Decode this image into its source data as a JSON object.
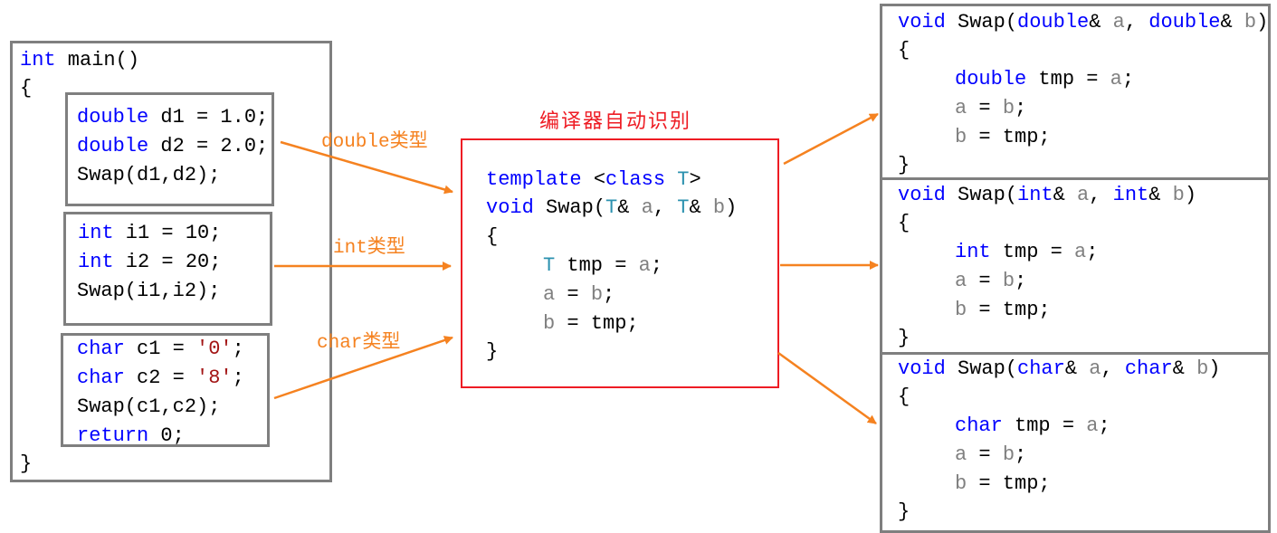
{
  "colors": {
    "arrow": "#f58220",
    "compiler_box": "#ee1c24",
    "box_border": "#7f7f7f",
    "keyword": "#0000ff",
    "type_param": "#2b91af",
    "param": "#808080",
    "literal": "#a31515"
  },
  "compiler_title": "编译器自动识别",
  "arrow_labels": {
    "double": "double类型",
    "int": "int类型",
    "char": "char类型"
  },
  "main_code": [
    [
      [
        "kw",
        "int"
      ],
      [
        "tx",
        " main()"
      ]
    ],
    [
      [
        "tx",
        "{"
      ]
    ],
    [
      [
        "kw",
        "double"
      ],
      [
        "tx",
        " d1 = 1.0;"
      ]
    ],
    [
      [
        "kw",
        "double"
      ],
      [
        "tx",
        " d2 = 2.0;"
      ]
    ],
    [
      [
        "tx",
        "Swap(d1,d2);"
      ]
    ],
    [
      [
        "kw",
        "int"
      ],
      [
        "tx",
        " i1 = 10;"
      ]
    ],
    [
      [
        "kw",
        "int"
      ],
      [
        "tx",
        " i2 = 20;"
      ]
    ],
    [
      [
        "tx",
        "Swap(i1,i2);"
      ]
    ],
    [
      [
        "kw",
        "char"
      ],
      [
        "tx",
        " c1 = "
      ],
      [
        "lit",
        "'0'"
      ],
      [
        "tx",
        ";"
      ]
    ],
    [
      [
        "kw",
        "char"
      ],
      [
        "tx",
        " c2 = "
      ],
      [
        "lit",
        "'8'"
      ],
      [
        "tx",
        ";"
      ]
    ],
    [
      [
        "tx",
        "Swap(c1,c2);"
      ]
    ],
    [
      [
        "kw",
        "return"
      ],
      [
        "tx",
        " 0;"
      ]
    ],
    [
      [
        "tx",
        "}"
      ]
    ]
  ],
  "template_code": [
    [
      [
        "kw",
        "template"
      ],
      [
        "tx",
        " <"
      ],
      [
        "kw",
        "class"
      ],
      [
        "tx",
        " "
      ],
      [
        "ty",
        "T"
      ],
      [
        "tx",
        ">"
      ]
    ],
    [
      [
        "kw",
        "void"
      ],
      [
        "tx",
        " Swap("
      ],
      [
        "ty",
        "T"
      ],
      [
        "tx",
        "& "
      ],
      [
        "pa",
        "a"
      ],
      [
        "tx",
        ", "
      ],
      [
        "ty",
        "T"
      ],
      [
        "tx",
        "& "
      ],
      [
        "pa",
        "b"
      ],
      [
        "tx",
        ")"
      ]
    ],
    [
      [
        "tx",
        "{"
      ]
    ],
    [
      [
        "ty",
        "T"
      ],
      [
        "tx",
        " tmp = "
      ],
      [
        "pa",
        "a"
      ],
      [
        "tx",
        ";"
      ]
    ],
    [
      [
        "pa",
        "a"
      ],
      [
        "tx",
        " = "
      ],
      [
        "pa",
        "b"
      ],
      [
        "tx",
        ";"
      ]
    ],
    [
      [
        "pa",
        "b"
      ],
      [
        "tx",
        " = tmp;"
      ]
    ],
    [
      [
        "tx",
        "}"
      ]
    ]
  ],
  "instances": [
    [
      [
        [
          "kw",
          "void"
        ],
        [
          "tx",
          " Swap("
        ],
        [
          "kw",
          "double"
        ],
        [
          "tx",
          "& "
        ],
        [
          "pa",
          "a"
        ],
        [
          "tx",
          ", "
        ],
        [
          "kw",
          "double"
        ],
        [
          "tx",
          "& "
        ],
        [
          "pa",
          "b"
        ],
        [
          "tx",
          ")"
        ]
      ],
      [
        [
          "tx",
          "{"
        ]
      ],
      [
        [
          "kw",
          "double"
        ],
        [
          "tx",
          " tmp = "
        ],
        [
          "pa",
          "a"
        ],
        [
          "tx",
          ";"
        ]
      ],
      [
        [
          "pa",
          "a"
        ],
        [
          "tx",
          " = "
        ],
        [
          "pa",
          "b"
        ],
        [
          "tx",
          ";"
        ]
      ],
      [
        [
          "pa",
          "b"
        ],
        [
          "tx",
          " = tmp;"
        ]
      ],
      [
        [
          "tx",
          "}"
        ]
      ]
    ],
    [
      [
        [
          "kw",
          "void"
        ],
        [
          "tx",
          " Swap("
        ],
        [
          "kw",
          "int"
        ],
        [
          "tx",
          "& "
        ],
        [
          "pa",
          "a"
        ],
        [
          "tx",
          ", "
        ],
        [
          "kw",
          "int"
        ],
        [
          "tx",
          "& "
        ],
        [
          "pa",
          "b"
        ],
        [
          "tx",
          ")"
        ]
      ],
      [
        [
          "tx",
          "{"
        ]
      ],
      [
        [
          "kw",
          "int"
        ],
        [
          "tx",
          " tmp = "
        ],
        [
          "pa",
          "a"
        ],
        [
          "tx",
          ";"
        ]
      ],
      [
        [
          "pa",
          "a"
        ],
        [
          "tx",
          " = "
        ],
        [
          "pa",
          "b"
        ],
        [
          "tx",
          ";"
        ]
      ],
      [
        [
          "pa",
          "b"
        ],
        [
          "tx",
          " = tmp;"
        ]
      ],
      [
        [
          "tx",
          "}"
        ]
      ]
    ],
    [
      [
        [
          "kw",
          "void"
        ],
        [
          "tx",
          " Swap("
        ],
        [
          "kw",
          "char"
        ],
        [
          "tx",
          "& "
        ],
        [
          "pa",
          "a"
        ],
        [
          "tx",
          ", "
        ],
        [
          "kw",
          "char"
        ],
        [
          "tx",
          "& "
        ],
        [
          "pa",
          "b"
        ],
        [
          "tx",
          ")"
        ]
      ],
      [
        [
          "tx",
          "{"
        ]
      ],
      [
        [
          "kw",
          "char"
        ],
        [
          "tx",
          " tmp = "
        ],
        [
          "pa",
          "a"
        ],
        [
          "tx",
          ";"
        ]
      ],
      [
        [
          "pa",
          "a"
        ],
        [
          "tx",
          " = "
        ],
        [
          "pa",
          "b"
        ],
        [
          "tx",
          ";"
        ]
      ],
      [
        [
          "pa",
          "b"
        ],
        [
          "tx",
          " = tmp;"
        ]
      ],
      [
        [
          "tx",
          "}"
        ]
      ]
    ]
  ]
}
